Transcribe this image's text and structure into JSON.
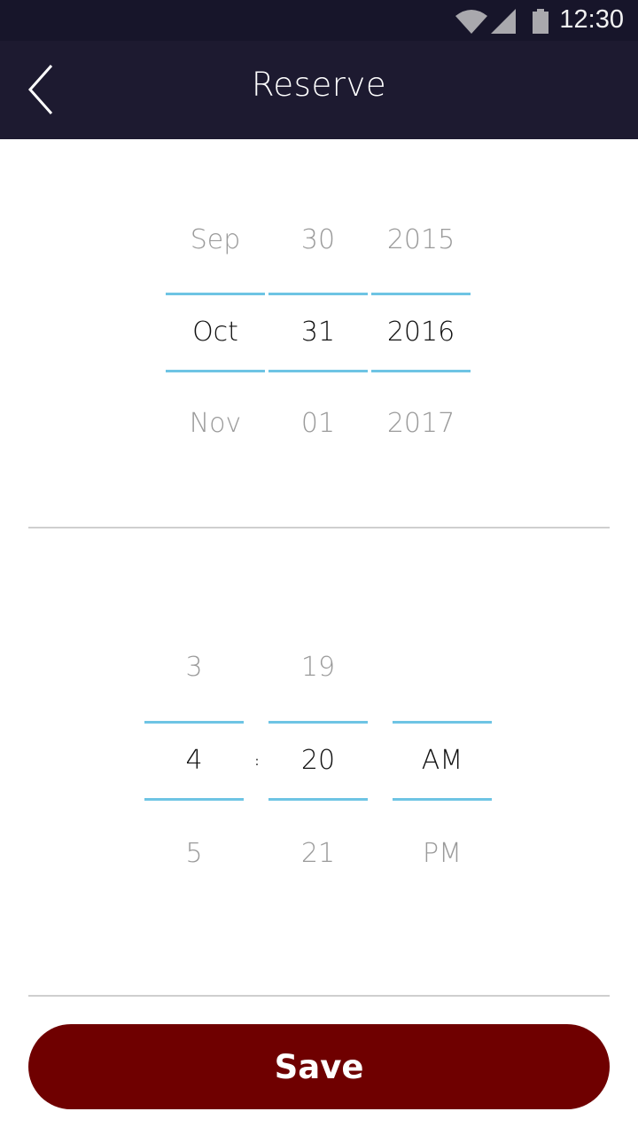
{
  "status_bar": {
    "time": "12:30",
    "icons": [
      "wifi-icon",
      "cellular-signal-icon",
      "battery-icon"
    ]
  },
  "app_bar": {
    "title": "Reserve",
    "back_icon": "chevron-left-icon"
  },
  "date_picker": {
    "month": {
      "prev": "Sep",
      "selected": "Oct",
      "next": "Nov"
    },
    "day": {
      "prev": "30",
      "selected": "31",
      "next": "01"
    },
    "year": {
      "prev": "2015",
      "selected": "2016",
      "next": "2017"
    }
  },
  "time_picker": {
    "hour": {
      "prev": "3",
      "selected": "4",
      "next": "5"
    },
    "separator": ":",
    "minute": {
      "prev": "19",
      "selected": "20",
      "next": "21"
    },
    "period": {
      "prev": "",
      "selected": "AM",
      "next": "PM"
    }
  },
  "save_button": {
    "label": "Save"
  },
  "colors": {
    "status_bar_bg": "#17152a",
    "app_bar_bg": "#1d1a30",
    "selection_line": "#6ec4e4",
    "save_button_bg": "#6f0000",
    "unselected_text": "#9a9a9a",
    "selected_text": "#111111",
    "divider": "#cfcfcf"
  }
}
